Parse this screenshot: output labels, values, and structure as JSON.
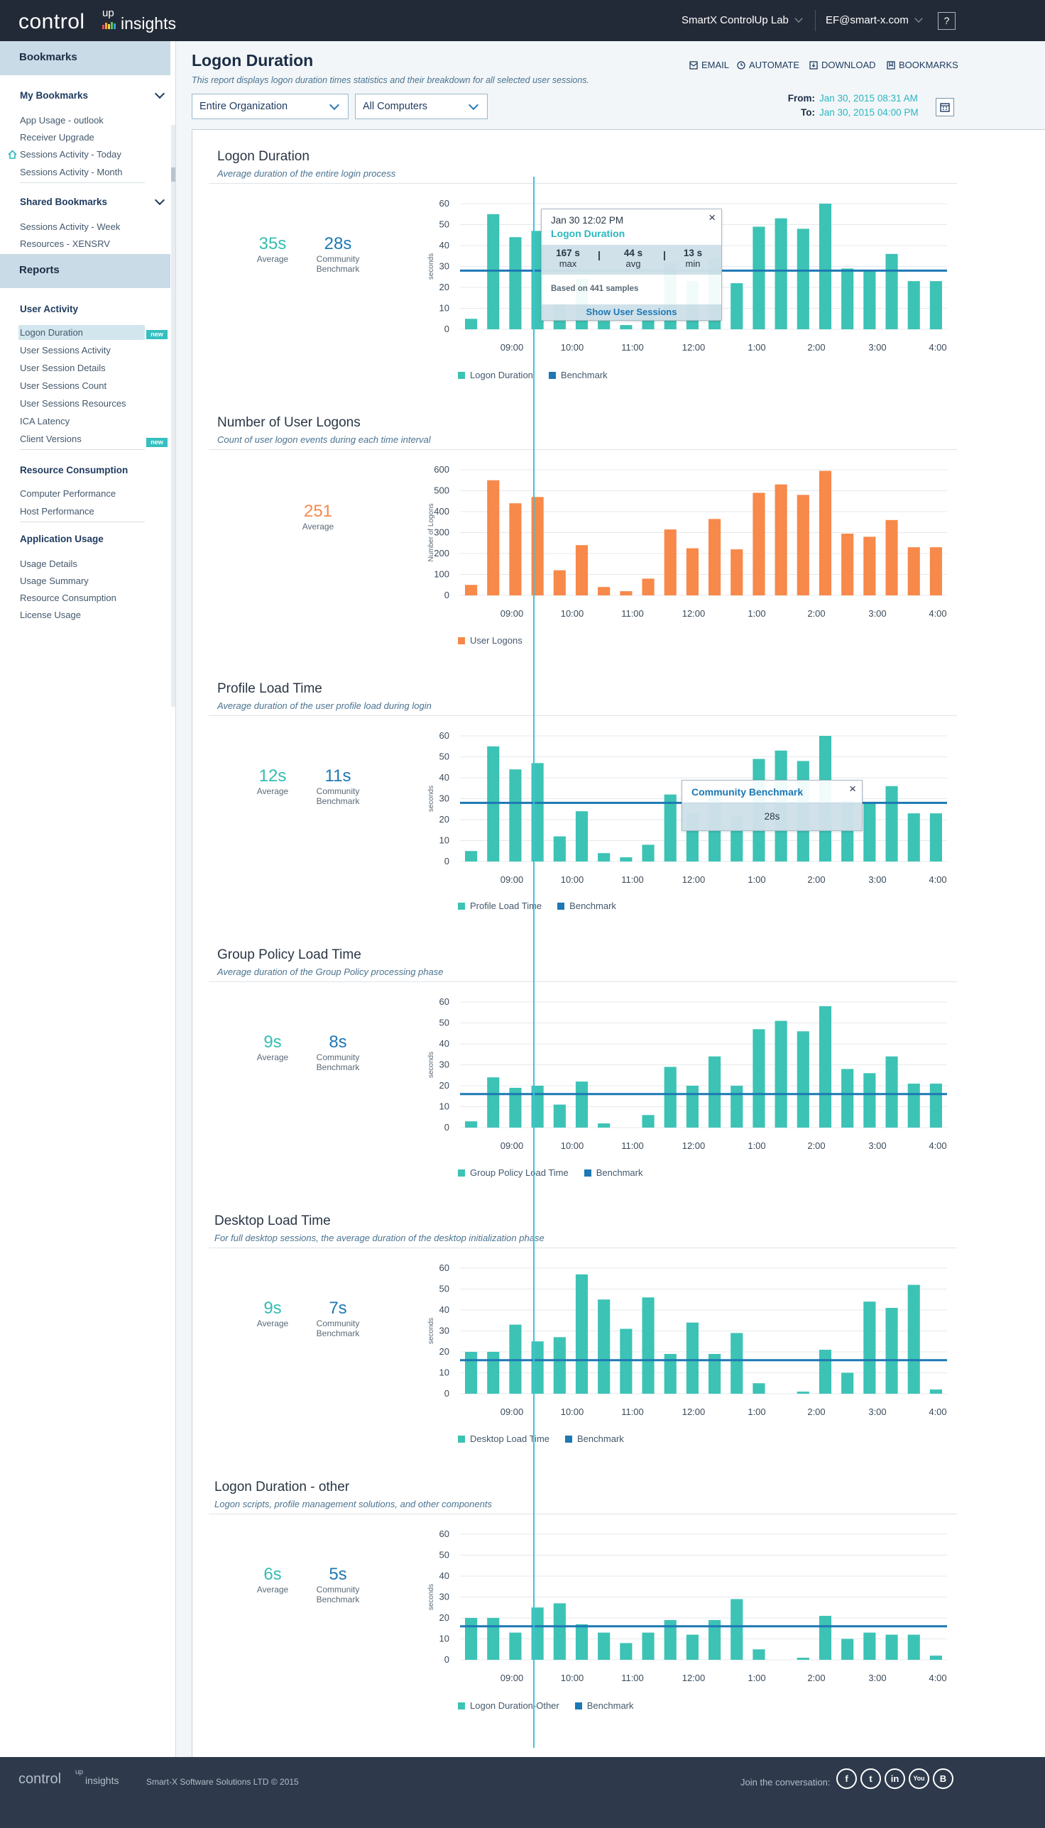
{
  "header": {
    "logo_control": "control",
    "logo_up": "up",
    "logo_insights": "insights",
    "org": "SmartX ControlUp Lab",
    "user": "EF@smart-x.com",
    "help": "?"
  },
  "sidebar": {
    "bookmarks_head": "Bookmarks",
    "my_bookmarks": "My Bookmarks",
    "my_items": [
      "App Usage - outlook",
      "Receiver Upgrade",
      "Sessions Activity - Today",
      "Sessions Activity - Month"
    ],
    "shared_bookmarks": "Shared Bookmarks",
    "shared_items": [
      "Sessions Activity - Week",
      "Resources - XENSRV"
    ],
    "reports_head": "Reports",
    "user_activity": "User Activity",
    "ua_items": [
      "Logon Duration",
      "User Sessions Activity",
      "User Session Details",
      "User Sessions Count",
      "User Sessions Resources",
      "ICA Latency",
      "Client Versions"
    ],
    "new_badge": "new",
    "resource_consumption": "Resource Consumption",
    "rc_items": [
      "Computer Performance",
      "Host Performance"
    ],
    "application_usage": "Application Usage",
    "au_items": [
      "Usage Details",
      "Usage Summary",
      "Resource Consumption",
      "License Usage"
    ]
  },
  "page": {
    "title": "Logon Duration",
    "description": "This report displays logon duration times statistics and their breakdown for all selected user sessions.",
    "actions": {
      "email": "EMAIL",
      "automate": "AUTOMATE",
      "download": "DOWNLOAD",
      "bookmarks": "BOOKMARKS"
    },
    "filter_org": "Entire Organization",
    "filter_computers": "All Computers",
    "from_label": "From:",
    "from_value": "Jan 30,  2015 08:31 AM",
    "to_label": "To:",
    "to_value": "Jan 30,  2015 04:00 PM"
  },
  "sections": [
    {
      "title": "Logon Duration",
      "subtitle": "Average duration of the entire login process",
      "average": "35s",
      "average_label": "Average",
      "benchmark": "28s",
      "benchmark_label": "Community Benchmark",
      "legend": [
        "Logon Duration",
        "Benchmark"
      ]
    },
    {
      "title": "Number of User Logons",
      "subtitle": "Count of user logon events during each time interval",
      "average": "251",
      "average_label": "Average",
      "legend": [
        "User Logons"
      ]
    },
    {
      "title": "Profile Load Time",
      "subtitle": "Average duration of the user profile load during login",
      "average": "12s",
      "average_label": "Average",
      "benchmark": "11s",
      "benchmark_label": "Community Benchmark",
      "legend": [
        "Profile Load Time",
        "Benchmark"
      ]
    },
    {
      "title": "Group Policy Load Time",
      "subtitle": "Average duration of the Group Policy processing phase",
      "average": "9s",
      "average_label": "Average",
      "benchmark": "8s",
      "benchmark_label": "Community Benchmark",
      "legend": [
        "Group Policy Load Time",
        "Benchmark"
      ]
    },
    {
      "title": "Desktop Load Time",
      "subtitle": "For full desktop sessions, the average duration of the desktop initialization phase",
      "average": "9s",
      "average_label": "Average",
      "benchmark": "7s",
      "benchmark_label": "Community Benchmark",
      "legend": [
        "Desktop Load Time",
        "Benchmark"
      ]
    },
    {
      "title": "Logon Duration - other",
      "subtitle": "Logon scripts, profile management solutions, and other components",
      "average": "6s",
      "average_label": "Average",
      "benchmark": "5s",
      "benchmark_label": "Community Benchmark",
      "legend": [
        "Logon Duration-Other",
        "Benchmark"
      ]
    }
  ],
  "tooltip_logon": {
    "date": "Jan 30 12:02 PM",
    "name": "Logon Duration",
    "max": "167 s",
    "max_label": "max",
    "avg": "44 s",
    "avg_label": "avg",
    "min": "13 s",
    "min_label": "min",
    "sep": "|",
    "samples": "Based on 441 samples",
    "show": "Show User Sessions",
    "close": "×"
  },
  "tooltip_bench": {
    "name": "Community Benchmark",
    "value": "28s",
    "close": "×"
  },
  "colors": {
    "teal": "#3cc3b5",
    "benchmark": "#1d78b4",
    "orange": "#f7894a"
  },
  "chart_data": [
    {
      "type": "bar",
      "title": "Logon Duration",
      "ylabel": "seconds",
      "ylim": [
        0,
        60
      ],
      "yticks": [
        0,
        10,
        20,
        30,
        40,
        50,
        60
      ],
      "x_tick_labels": [
        "09:00",
        "10:00",
        "11:00",
        "12:00",
        "1:00",
        "2:00",
        "3:00",
        "4:00"
      ],
      "series": [
        {
          "name": "Logon Duration",
          "values": [
            5,
            55,
            44,
            47,
            12,
            24,
            4,
            2,
            8,
            32,
            23,
            34,
            22,
            49,
            53,
            48,
            60,
            29,
            28,
            36,
            23,
            23
          ]
        }
      ],
      "benchmark": 28
    },
    {
      "type": "bar",
      "title": "Number of User Logons",
      "ylabel": "Number of Logons",
      "ylim": [
        0,
        600
      ],
      "yticks": [
        0,
        100,
        200,
        300,
        400,
        500,
        600
      ],
      "x_tick_labels": [
        "09:00",
        "10:00",
        "11:00",
        "12:00",
        "1:00",
        "2:00",
        "3:00",
        "4:00"
      ],
      "series": [
        {
          "name": "User Logons",
          "values": [
            50,
            550,
            440,
            470,
            120,
            240,
            40,
            20,
            80,
            315,
            225,
            365,
            220,
            490,
            530,
            480,
            595,
            295,
            280,
            360,
            230,
            230
          ]
        }
      ]
    },
    {
      "type": "bar",
      "title": "Profile Load Time",
      "ylabel": "seconds",
      "ylim": [
        0,
        60
      ],
      "yticks": [
        0,
        10,
        20,
        30,
        40,
        50,
        60
      ],
      "x_tick_labels": [
        "09:00",
        "10:00",
        "11:00",
        "12:00",
        "1:00",
        "2:00",
        "3:00",
        "4:00"
      ],
      "series": [
        {
          "name": "Profile Load Time",
          "values": [
            5,
            55,
            44,
            47,
            12,
            24,
            4,
            2,
            8,
            32,
            23,
            34,
            22,
            49,
            53,
            48,
            60,
            29,
            28,
            36,
            23,
            23
          ]
        }
      ],
      "benchmark": 28
    },
    {
      "type": "bar",
      "title": "Group Policy Load Time",
      "ylabel": "seconds",
      "ylim": [
        0,
        60
      ],
      "yticks": [
        0,
        10,
        20,
        30,
        40,
        50,
        60
      ],
      "x_tick_labels": [
        "09:00",
        "10:00",
        "11:00",
        "12:00",
        "1:00",
        "2:00",
        "3:00",
        "4:00"
      ],
      "series": [
        {
          "name": "Group Policy Load Time",
          "values": [
            3,
            24,
            19,
            20,
            11,
            22,
            2,
            0,
            6,
            29,
            20,
            34,
            20,
            47,
            51,
            46,
            58,
            28,
            26,
            34,
            21,
            21
          ]
        }
      ],
      "benchmark": 16
    },
    {
      "type": "bar",
      "title": "Desktop Load Time",
      "ylabel": "seconds",
      "ylim": [
        0,
        60
      ],
      "yticks": [
        0,
        10,
        20,
        30,
        40,
        50,
        60
      ],
      "x_tick_labels": [
        "09:00",
        "10:00",
        "11:00",
        "12:00",
        "1:00",
        "2:00",
        "3:00",
        "4:00"
      ],
      "series": [
        {
          "name": "Desktop Load Time",
          "values": [
            20,
            20,
            33,
            25,
            27,
            57,
            45,
            31,
            46,
            19,
            34,
            19,
            29,
            5,
            0,
            1,
            21,
            10,
            44,
            41,
            52,
            2
          ]
        }
      ],
      "benchmark": 16
    },
    {
      "type": "bar",
      "title": "Logon Duration - other",
      "ylabel": "seconds",
      "ylim": [
        0,
        60
      ],
      "yticks": [
        0,
        10,
        20,
        30,
        40,
        50,
        60
      ],
      "x_tick_labels": [
        "09:00",
        "10:00",
        "11:00",
        "12:00",
        "1:00",
        "2:00",
        "3:00",
        "4:00"
      ],
      "series": [
        {
          "name": "Logon Duration-Other",
          "values": [
            20,
            20,
            13,
            25,
            27,
            17,
            13,
            8,
            13,
            19,
            12,
            19,
            29,
            5,
            0,
            1,
            21,
            10,
            13,
            12,
            12,
            2
          ]
        }
      ],
      "benchmark": 16
    }
  ]
}
